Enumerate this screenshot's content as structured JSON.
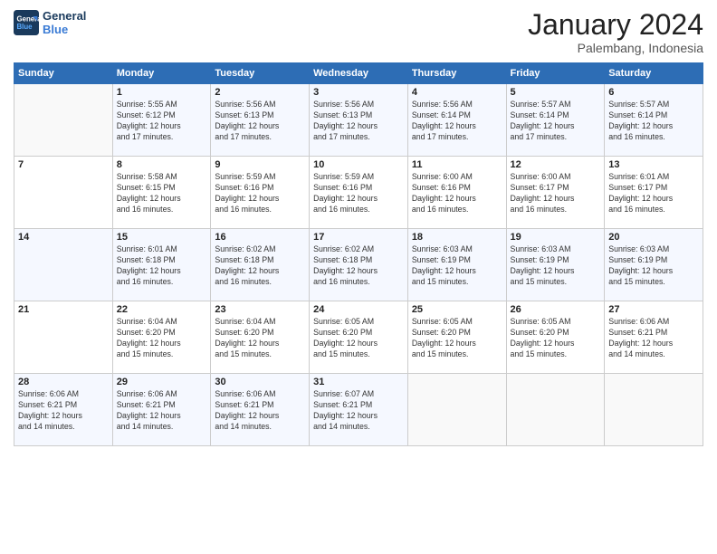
{
  "header": {
    "logo_line1": "General",
    "logo_line2": "Blue",
    "month_title": "January 2024",
    "location": "Palembang, Indonesia"
  },
  "days_of_week": [
    "Sunday",
    "Monday",
    "Tuesday",
    "Wednesday",
    "Thursday",
    "Friday",
    "Saturday"
  ],
  "weeks": [
    [
      {
        "day": "",
        "info": ""
      },
      {
        "day": "1",
        "info": "Sunrise: 5:55 AM\nSunset: 6:12 PM\nDaylight: 12 hours\nand 17 minutes."
      },
      {
        "day": "2",
        "info": "Sunrise: 5:56 AM\nSunset: 6:13 PM\nDaylight: 12 hours\nand 17 minutes."
      },
      {
        "day": "3",
        "info": "Sunrise: 5:56 AM\nSunset: 6:13 PM\nDaylight: 12 hours\nand 17 minutes."
      },
      {
        "day": "4",
        "info": "Sunrise: 5:56 AM\nSunset: 6:14 PM\nDaylight: 12 hours\nand 17 minutes."
      },
      {
        "day": "5",
        "info": "Sunrise: 5:57 AM\nSunset: 6:14 PM\nDaylight: 12 hours\nand 17 minutes."
      },
      {
        "day": "6",
        "info": "Sunrise: 5:57 AM\nSunset: 6:14 PM\nDaylight: 12 hours\nand 16 minutes."
      }
    ],
    [
      {
        "day": "7",
        "info": ""
      },
      {
        "day": "8",
        "info": "Sunrise: 5:58 AM\nSunset: 6:15 PM\nDaylight: 12 hours\nand 16 minutes."
      },
      {
        "day": "9",
        "info": "Sunrise: 5:59 AM\nSunset: 6:16 PM\nDaylight: 12 hours\nand 16 minutes."
      },
      {
        "day": "10",
        "info": "Sunrise: 5:59 AM\nSunset: 6:16 PM\nDaylight: 12 hours\nand 16 minutes."
      },
      {
        "day": "11",
        "info": "Sunrise: 6:00 AM\nSunset: 6:16 PM\nDaylight: 12 hours\nand 16 minutes."
      },
      {
        "day": "12",
        "info": "Sunrise: 6:00 AM\nSunset: 6:17 PM\nDaylight: 12 hours\nand 16 minutes."
      },
      {
        "day": "13",
        "info": "Sunrise: 6:01 AM\nSunset: 6:17 PM\nDaylight: 12 hours\nand 16 minutes."
      }
    ],
    [
      {
        "day": "14",
        "info": ""
      },
      {
        "day": "15",
        "info": "Sunrise: 6:01 AM\nSunset: 6:18 PM\nDaylight: 12 hours\nand 16 minutes."
      },
      {
        "day": "16",
        "info": "Sunrise: 6:02 AM\nSunset: 6:18 PM\nDaylight: 12 hours\nand 16 minutes."
      },
      {
        "day": "17",
        "info": "Sunrise: 6:02 AM\nSunset: 6:18 PM\nDaylight: 12 hours\nand 16 minutes."
      },
      {
        "day": "18",
        "info": "Sunrise: 6:03 AM\nSunset: 6:19 PM\nDaylight: 12 hours\nand 15 minutes."
      },
      {
        "day": "19",
        "info": "Sunrise: 6:03 AM\nSunset: 6:19 PM\nDaylight: 12 hours\nand 15 minutes."
      },
      {
        "day": "20",
        "info": "Sunrise: 6:03 AM\nSunset: 6:19 PM\nDaylight: 12 hours\nand 15 minutes."
      }
    ],
    [
      {
        "day": "21",
        "info": ""
      },
      {
        "day": "22",
        "info": "Sunrise: 6:04 AM\nSunset: 6:20 PM\nDaylight: 12 hours\nand 15 minutes."
      },
      {
        "day": "23",
        "info": "Sunrise: 6:04 AM\nSunset: 6:20 PM\nDaylight: 12 hours\nand 15 minutes."
      },
      {
        "day": "24",
        "info": "Sunrise: 6:05 AM\nSunset: 6:20 PM\nDaylight: 12 hours\nand 15 minutes."
      },
      {
        "day": "25",
        "info": "Sunrise: 6:05 AM\nSunset: 6:20 PM\nDaylight: 12 hours\nand 15 minutes."
      },
      {
        "day": "26",
        "info": "Sunrise: 6:05 AM\nSunset: 6:20 PM\nDaylight: 12 hours\nand 15 minutes."
      },
      {
        "day": "27",
        "info": "Sunrise: 6:06 AM\nSunset: 6:21 PM\nDaylight: 12 hours\nand 14 minutes."
      }
    ],
    [
      {
        "day": "28",
        "info": "Sunrise: 6:06 AM\nSunset: 6:21 PM\nDaylight: 12 hours\nand 14 minutes."
      },
      {
        "day": "29",
        "info": "Sunrise: 6:06 AM\nSunset: 6:21 PM\nDaylight: 12 hours\nand 14 minutes."
      },
      {
        "day": "30",
        "info": "Sunrise: 6:06 AM\nSunset: 6:21 PM\nDaylight: 12 hours\nand 14 minutes."
      },
      {
        "day": "31",
        "info": "Sunrise: 6:07 AM\nSunset: 6:21 PM\nDaylight: 12 hours\nand 14 minutes."
      },
      {
        "day": "",
        "info": ""
      },
      {
        "day": "",
        "info": ""
      },
      {
        "day": "",
        "info": ""
      }
    ]
  ]
}
